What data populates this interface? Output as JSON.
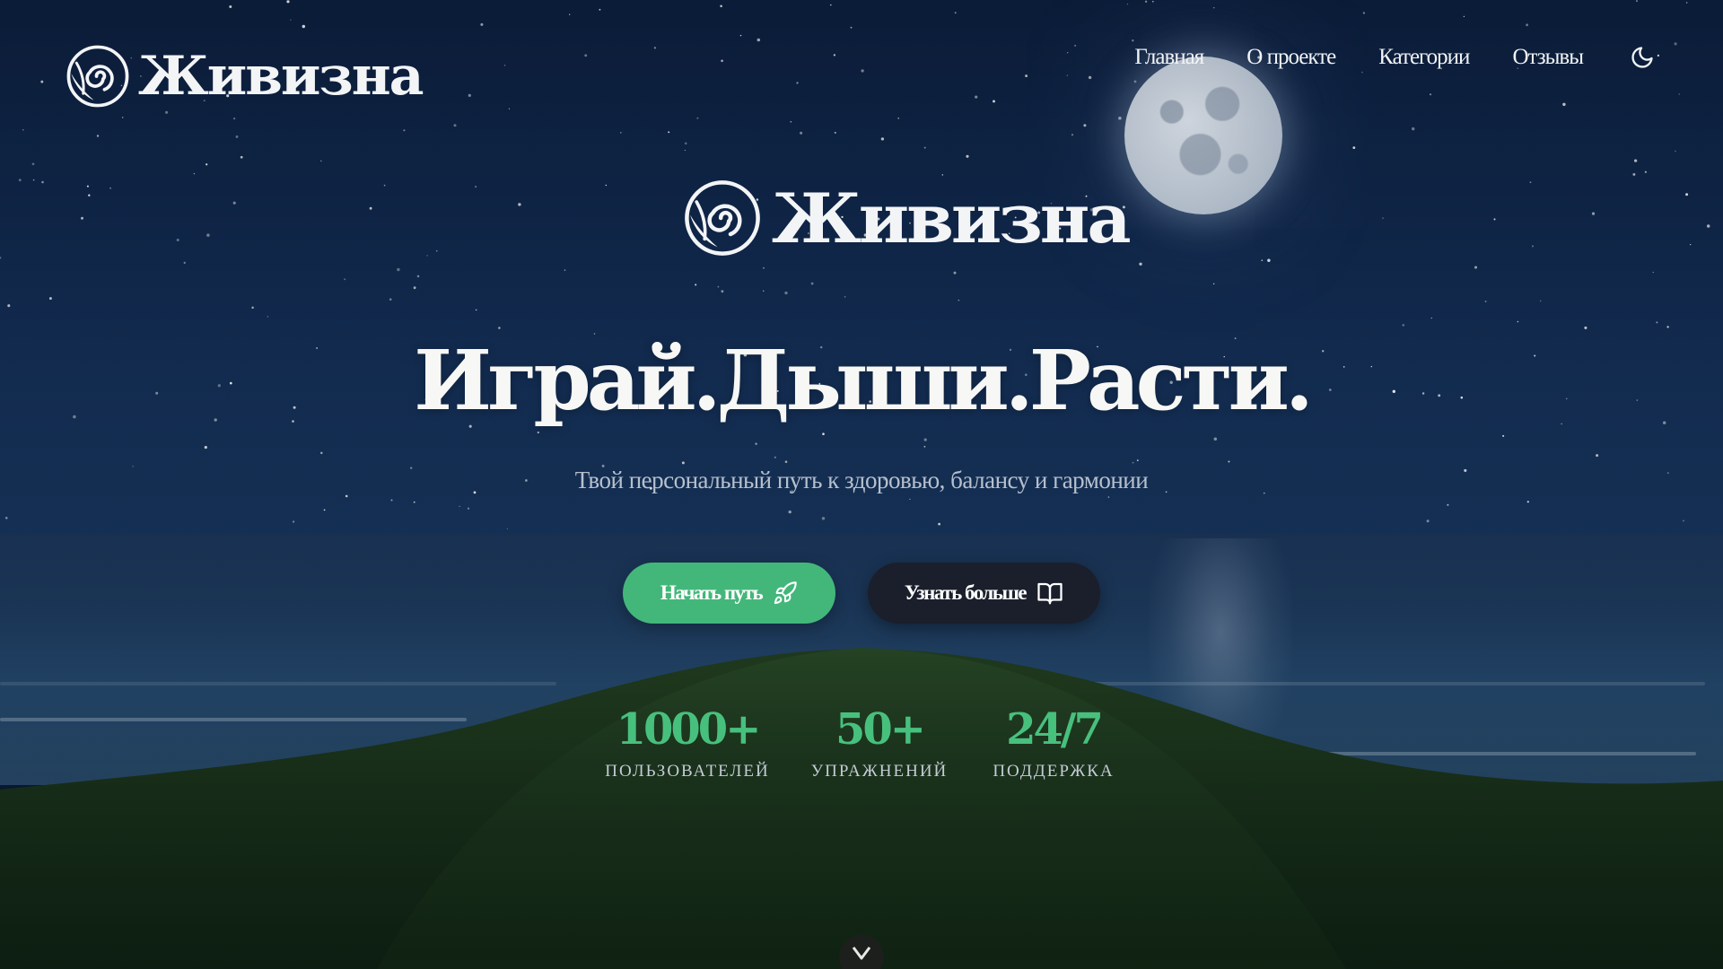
{
  "brand": {
    "name": "Живизна",
    "logo_icon": "spiral-leaf-logo-icon"
  },
  "nav": {
    "items": [
      {
        "label": "Главная"
      },
      {
        "label": "О проекте"
      },
      {
        "label": "Категории"
      },
      {
        "label": "Отзывы"
      }
    ],
    "theme_toggle_icon": "moon-icon"
  },
  "hero": {
    "title": "Играй.Дыши.Расти.",
    "subtitle": "Твой персональный путь к здоровью, балансу и гармонии",
    "primary_button": {
      "label": "Начать путь",
      "icon": "rocket-icon",
      "color": "#43b77a"
    },
    "secondary_button": {
      "label": "Узнать больше",
      "icon": "open-book-icon",
      "color": "#1a1f2b"
    }
  },
  "stats": [
    {
      "value": "1000+",
      "label": "ПОЛЬЗОВАТЕЛЕЙ"
    },
    {
      "value": "50+",
      "label": "УПРАЖНЕНИЙ"
    },
    {
      "value": "24/7",
      "label": "ПОДДЕРЖКА"
    }
  ],
  "scroll_indicator_icon": "chevron-down-icon",
  "colors": {
    "accent": "#43b77a",
    "stat_value": "#48c07d",
    "sky": "#0b1d3a"
  }
}
